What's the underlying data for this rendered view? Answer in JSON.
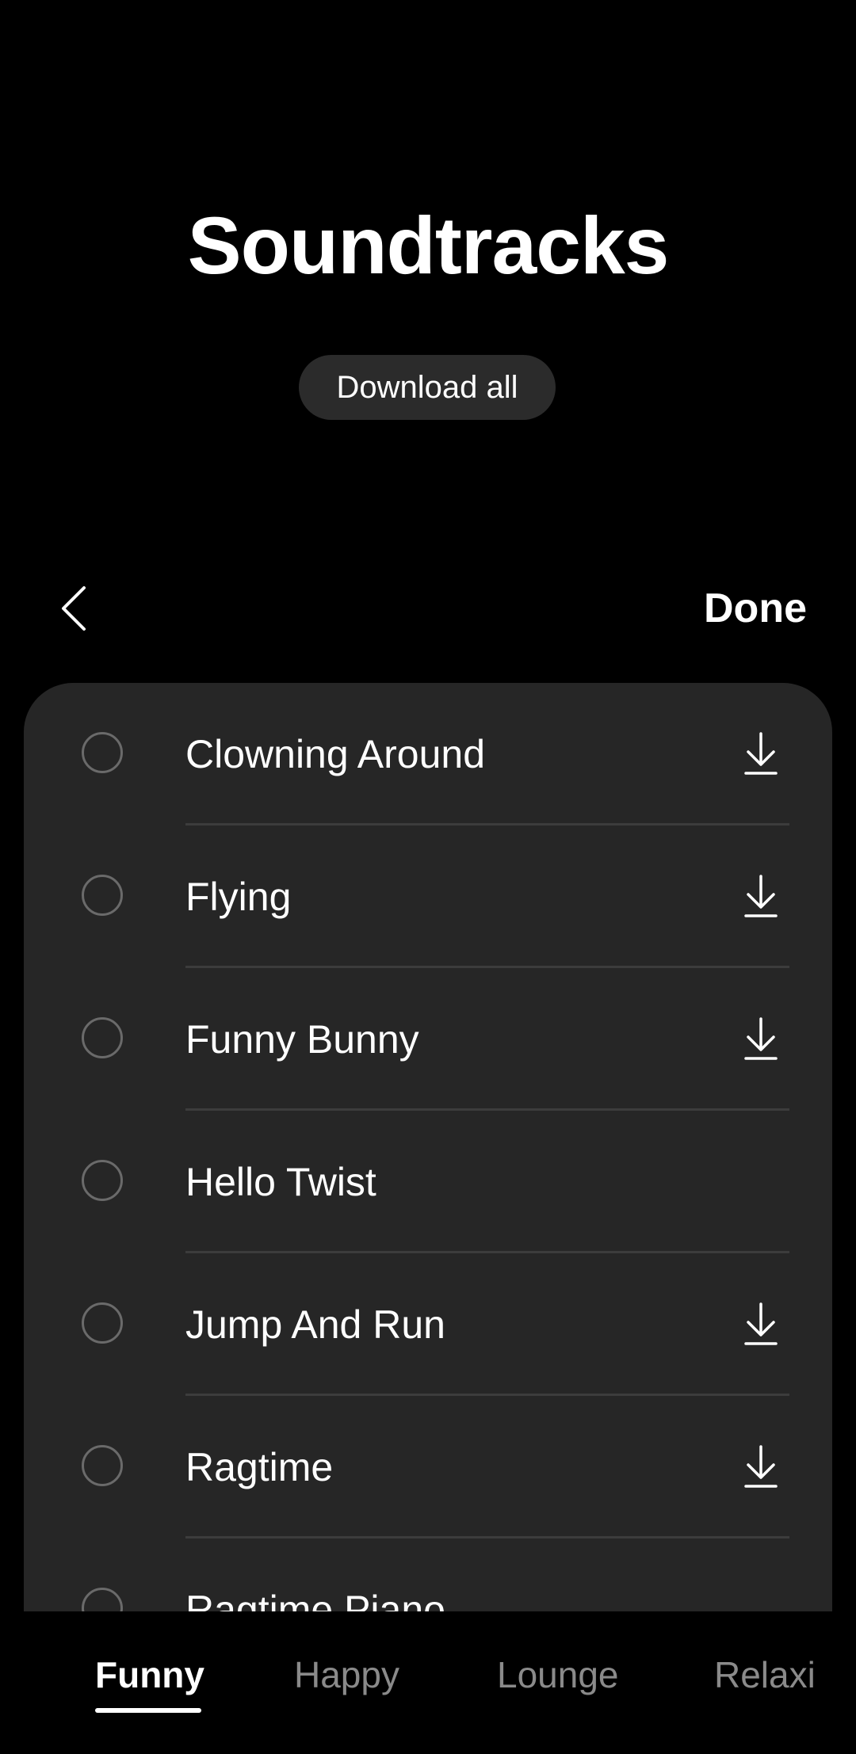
{
  "header": {
    "title": "Soundtracks",
    "download_all_label": "Download all"
  },
  "toolbar": {
    "back_icon": "chevron-left-icon",
    "done_label": "Done"
  },
  "tracks": [
    {
      "name": "Clowning Around",
      "downloadable": true
    },
    {
      "name": "Flying",
      "downloadable": true
    },
    {
      "name": "Funny Bunny",
      "downloadable": true
    },
    {
      "name": "Hello Twist",
      "downloadable": false
    },
    {
      "name": "Jump And Run",
      "downloadable": true
    },
    {
      "name": "Ragtime",
      "downloadable": true
    },
    {
      "name": "Ragtime Piano",
      "downloadable": false
    }
  ],
  "tabs": [
    {
      "label": "Funny",
      "active": true
    },
    {
      "label": "Happy",
      "active": false
    },
    {
      "label": "Lounge",
      "active": false
    },
    {
      "label": "Relaxi",
      "active": false
    }
  ],
  "colors": {
    "background": "#000000",
    "card": "#262626",
    "pill": "#2b2b2b",
    "inactive_tab": "#8a8a8a"
  }
}
